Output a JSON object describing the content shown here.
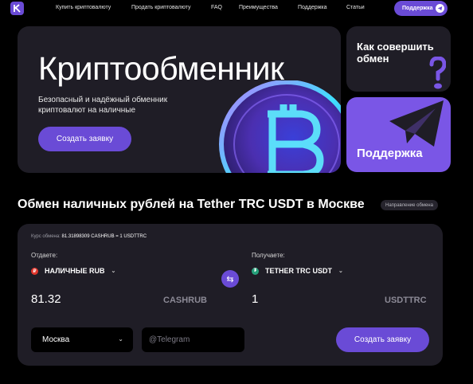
{
  "nav": {
    "links": [
      "Купить криптовалюту",
      "Продать криптовалюту",
      "FAQ",
      "Преимущества",
      "Поддержка",
      "Статьи"
    ],
    "support_label": "Поддержка"
  },
  "hero": {
    "title": "Криптообменник",
    "subtitle": "Безопасный и надёжный обменник криптовалют на наличные",
    "cta": "Создать заявку"
  },
  "cards": {
    "how_title": "Как совершить обмен",
    "support_title": "Поддержка"
  },
  "section": {
    "title": "Обмен наличных рублей на Tether TRC USDT в Москве",
    "badge": "Направление обмена"
  },
  "exchange": {
    "rate_label": "Курс обмена:",
    "rate_value": "81.31898309 CASHRUB = 1 USDTTRC",
    "give_label": "Отдаете:",
    "give_currency": "НАЛИЧНЫЕ RUB",
    "give_amount": "81.32",
    "give_code": "CASHRUB",
    "get_label": "Получаете:",
    "get_currency": "TETHER TRC USDT",
    "get_amount": "1",
    "get_code": "USDTTRC",
    "city": "Москва",
    "telegram_placeholder": "@Telegram",
    "submit": "Создать заявку"
  },
  "colors": {
    "accent": "#6a4bd6",
    "card": "#1f1d26",
    "support_card": "#7a56e6",
    "rub_icon": "#e0352b",
    "usdt_icon": "#26a17b"
  }
}
